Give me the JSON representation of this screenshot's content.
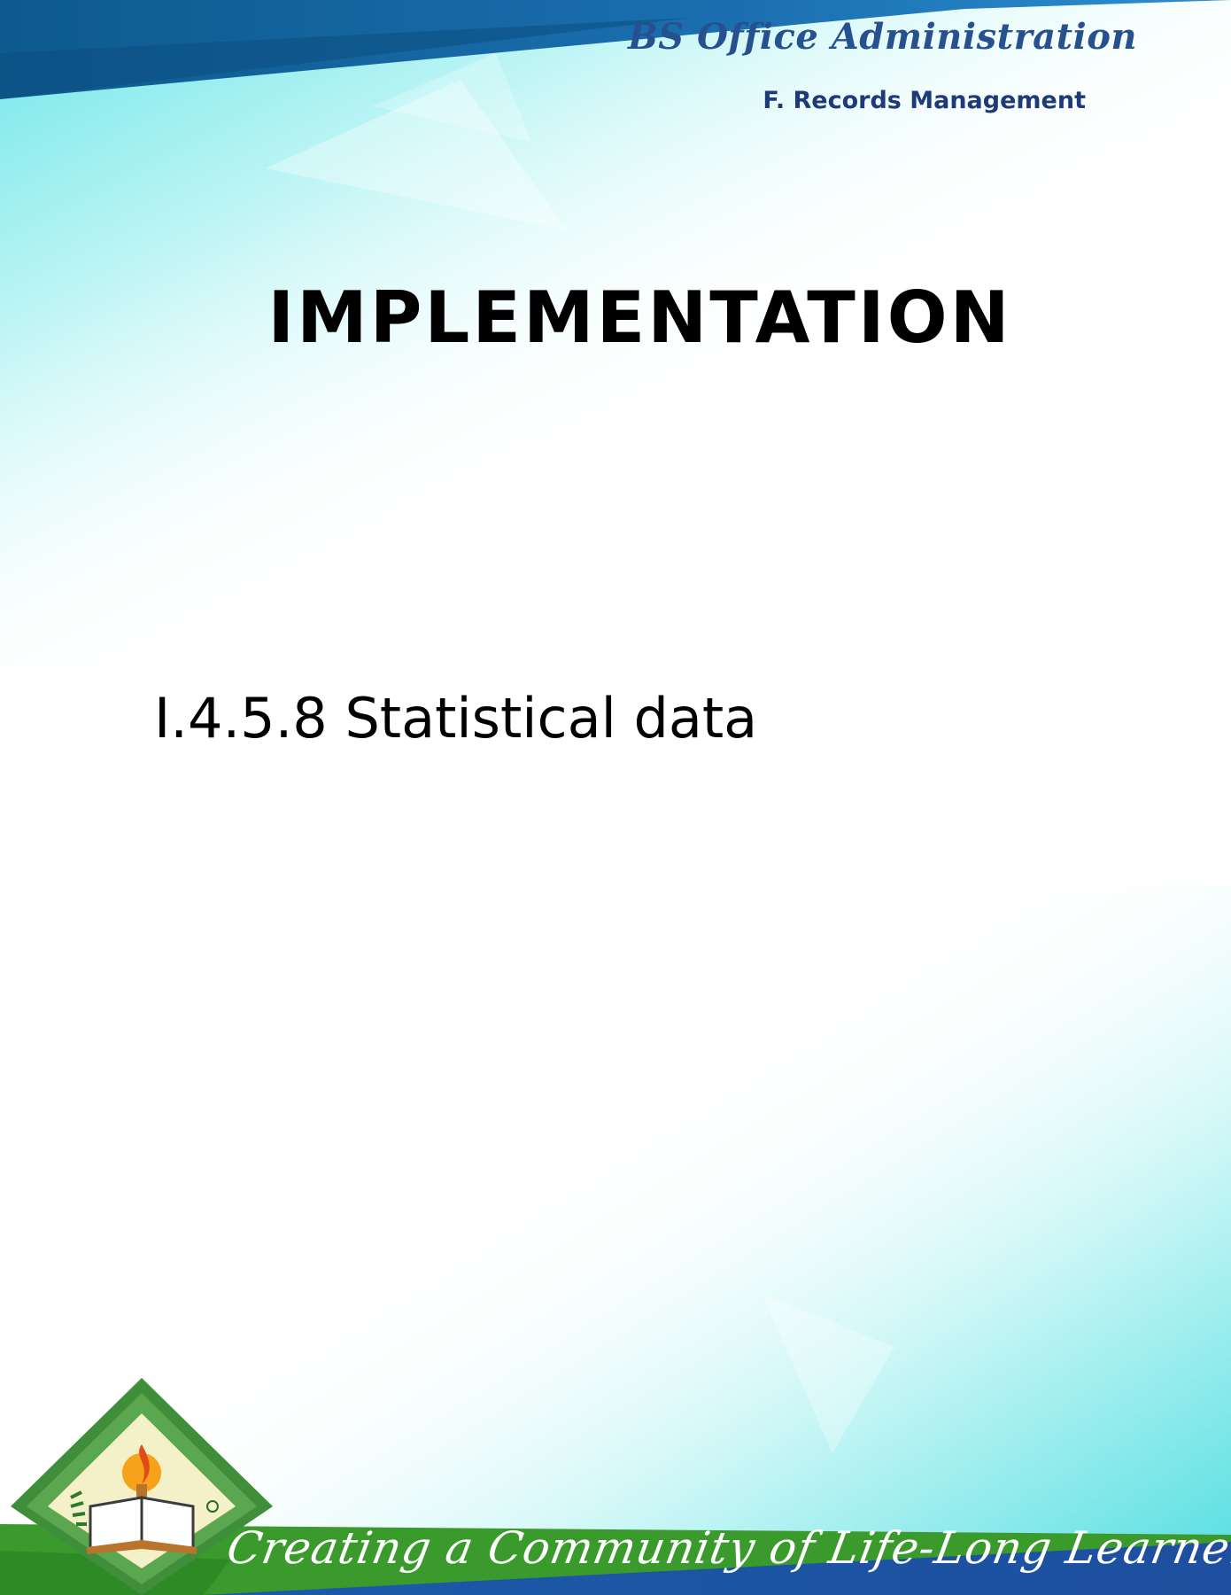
{
  "header": {
    "program": "BS Office Administration",
    "subject": "F. Records Management"
  },
  "title": "IMPLEMENTATION",
  "section": {
    "heading": "I.4.5.8 Statistical data"
  },
  "footer": {
    "tagline": "Creating a Community of Life-Long Learners",
    "logo_icon": "university-seal-icon"
  },
  "colors": {
    "top_band": "#1b5fa3",
    "teal_wash": "#6fe3e3",
    "footer_green": "#2f8f2f",
    "footer_blue": "#1a56a6",
    "heading_text": "#27508f"
  }
}
